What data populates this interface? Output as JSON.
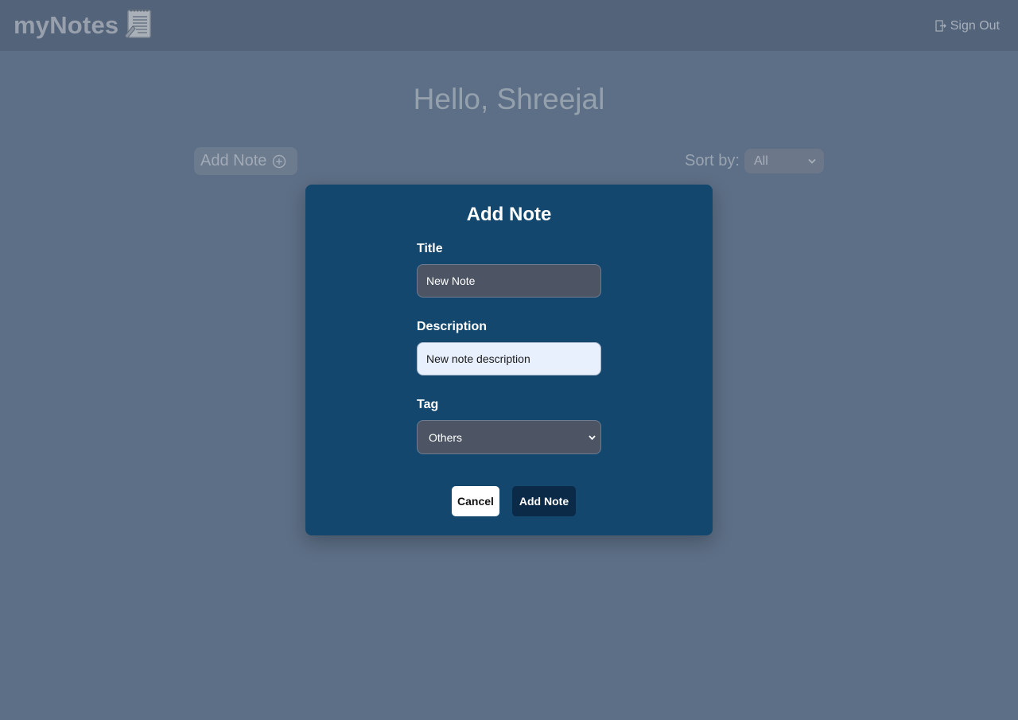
{
  "header": {
    "brand": "myNotes",
    "brand_icon": "notepad-icon",
    "signout_label": "Sign Out",
    "signout_icon": "door-exit-icon"
  },
  "main": {
    "greeting": "Hello, Shreejal",
    "add_note_label": "Add Note",
    "add_note_icon": "plus-circle-icon",
    "sort_label": "Sort by:",
    "sort_value": "All"
  },
  "modal": {
    "title": "Add Note",
    "title_label": "Title",
    "title_value": "New Note",
    "description_label": "Description",
    "description_value": "New note description",
    "tag_label": "Tag",
    "tag_value": "Others",
    "cancel_label": "Cancel",
    "submit_label": "Add Note"
  },
  "colors": {
    "page_overlay": "#5d6f86",
    "navbar": "#53637a",
    "modal_bg": "#13476e",
    "primary_button": "#0b2a48"
  }
}
